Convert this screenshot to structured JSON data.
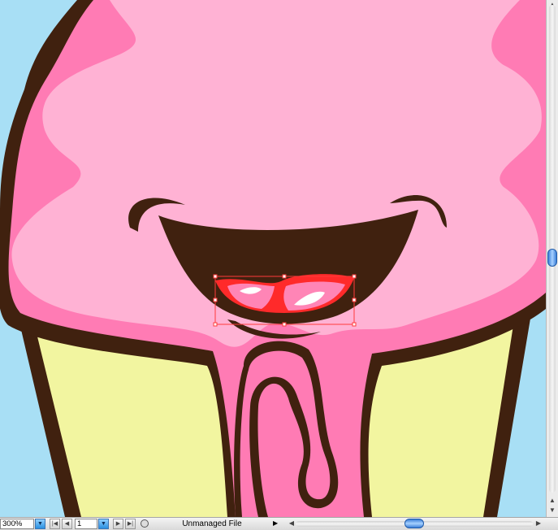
{
  "zoom": {
    "value": "300%"
  },
  "page": {
    "value": "1"
  },
  "status": {
    "text": "Unmanaged File"
  },
  "colors": {
    "background": "#a8dff5",
    "outline": "#40210f",
    "frosting_light": "#ffb2d4",
    "frosting_dark": "#ff7bb4",
    "cone": "#f2f5a0",
    "selection": "#ff2a2a"
  },
  "icons": {
    "zoom_dropdown": "chevron-down-icon",
    "first_page": "first-page-icon",
    "prev_page": "previous-page-icon",
    "next_page": "next-page-icon",
    "last_page": "last-page-icon",
    "status": "status-info-icon"
  }
}
